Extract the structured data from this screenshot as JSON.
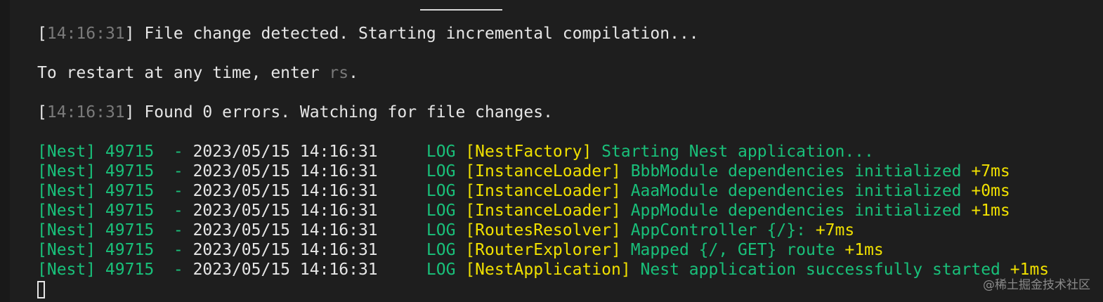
{
  "colors": {
    "background": "#1e1e1e",
    "text": "#e6e6e6",
    "timestamp_dim": "#7a7a7a",
    "nest_green": "#19c07a",
    "context_yellow": "#f0e000"
  },
  "terminal": {
    "line1": {
      "open": "[",
      "time": "14:16:31",
      "close": "]",
      "message": " File change detected. Starting incremental compilation..."
    },
    "line2": {
      "prefix": "To restart at any time, enter ",
      "cmd": "rs",
      "suffix": "."
    },
    "line3": {
      "open": "[",
      "time": "14:16:31",
      "close": "]",
      "message": " Found 0 errors. Watching for file changes."
    },
    "logs": [
      {
        "tag": "[Nest] 49715  - ",
        "datetime": "2023/05/15 14:16:31",
        "level": "     LOG ",
        "context": "[NestFactory]",
        "message": " Starting Nest application...",
        "timing": ""
      },
      {
        "tag": "[Nest] 49715  - ",
        "datetime": "2023/05/15 14:16:31",
        "level": "     LOG ",
        "context": "[InstanceLoader]",
        "message": " BbbModule dependencies initialized ",
        "timing": "+7ms"
      },
      {
        "tag": "[Nest] 49715  - ",
        "datetime": "2023/05/15 14:16:31",
        "level": "     LOG ",
        "context": "[InstanceLoader]",
        "message": " AaaModule dependencies initialized ",
        "timing": "+0ms"
      },
      {
        "tag": "[Nest] 49715  - ",
        "datetime": "2023/05/15 14:16:31",
        "level": "     LOG ",
        "context": "[InstanceLoader]",
        "message": " AppModule dependencies initialized ",
        "timing": "+1ms"
      },
      {
        "tag": "[Nest] 49715  - ",
        "datetime": "2023/05/15 14:16:31",
        "level": "     LOG ",
        "context": "[RoutesResolver]",
        "message": " AppController {/}: ",
        "timing": "+7ms"
      },
      {
        "tag": "[Nest] 49715  - ",
        "datetime": "2023/05/15 14:16:31",
        "level": "     LOG ",
        "context": "[RouterExplorer]",
        "message": " Mapped {/, GET} route ",
        "timing": "+1ms"
      },
      {
        "tag": "[Nest] 49715  - ",
        "datetime": "2023/05/15 14:16:31",
        "level": "     LOG ",
        "context": "[NestApplication]",
        "message": " Nest application successfully started ",
        "timing": "+1ms"
      }
    ]
  },
  "watermark": "@稀土掘金技术社区"
}
